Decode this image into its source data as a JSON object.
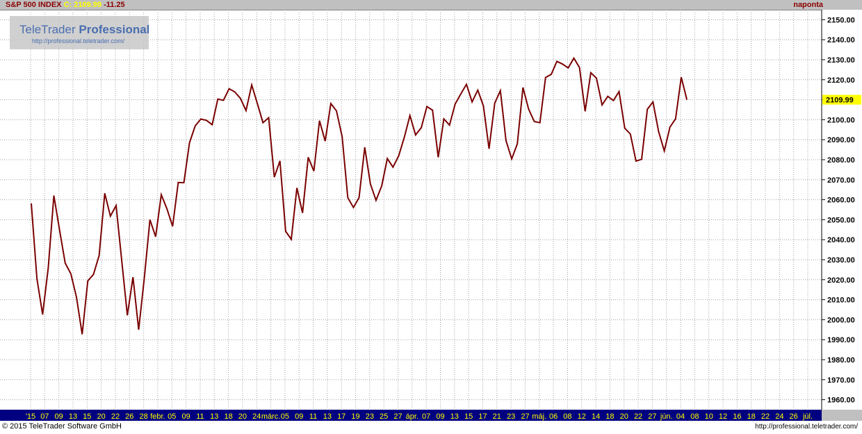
{
  "header": {
    "symbol": "S&P 500 INDEX",
    "close_label": "C:",
    "close_value": "2109.99",
    "change": "-11.25",
    "period": "naponta"
  },
  "watermark": {
    "brand": "TeleTrader",
    "brand_bold": "Professional",
    "url": "http://professional.teletrader.com/"
  },
  "footer": {
    "copyright": "© 2015 TeleTrader Software GmbH",
    "url": "http://professional.teletrader.com/"
  },
  "colors": {
    "line": "#7a0000",
    "grid": "#a0a0a0",
    "axis_bar": "#000080",
    "axis_text": "#ffff00",
    "last_price_bg": "#ffff00"
  },
  "chart_data": {
    "type": "line",
    "title": "S&P 500 INDEX",
    "xlabel": "",
    "ylabel": "",
    "ylim": [
      1955,
      2155
    ],
    "y_ticks": [
      "2150.00",
      "2140.00",
      "2130.00",
      "2120.00",
      "2110.00",
      "2100.00",
      "2090.00",
      "2080.00",
      "2070.00",
      "2060.00",
      "2050.00",
      "2040.00",
      "2030.00",
      "2020.00",
      "2010.00",
      "2000.00",
      "1990.00",
      "1980.00",
      "1970.00",
      "1960.00"
    ],
    "last_price_label": "2109.99",
    "grid": true,
    "x_tick_labels": [
      "'15",
      "07",
      "09",
      "13",
      "15",
      "20",
      "22",
      "26",
      "28",
      "febr.",
      "05",
      "09",
      "11",
      "13",
      "18",
      "20",
      "24",
      "márc.",
      "05",
      "09",
      "11",
      "13",
      "17",
      "19",
      "23",
      "25",
      "27",
      "ápr.",
      "07",
      "09",
      "13",
      "15",
      "17",
      "21",
      "23",
      "27",
      "máj.",
      "06",
      "08",
      "12",
      "14",
      "18",
      "20",
      "22",
      "27",
      "jún.",
      "04",
      "08",
      "10",
      "12",
      "16",
      "18",
      "22",
      "24",
      "26",
      "júl."
    ],
    "series": [
      {
        "values": [
          2058.2,
          2020.6,
          2002.6,
          2025.9,
          2062.1,
          2044.8,
          2028.3,
          2023.0,
          2011.3,
          1992.7,
          2019.4,
          2022.6,
          2032.1,
          2063.2,
          2051.8,
          2057.1,
          2029.6,
          2002.2,
          2021.3,
          1995.0,
          2020.9,
          2050.0,
          2041.5,
          2062.5,
          2055.5,
          2046.7,
          2068.6,
          2068.5,
          2088.5,
          2096.9,
          2100.3,
          2099.7,
          2097.5,
          2110.3,
          2109.7,
          2115.5,
          2113.9,
          2110.7,
          2104.6,
          2117.4,
          2108.1,
          2098.5,
          2101.0,
          2071.3,
          2079.4,
          2044.2,
          2040.2,
          2065.9,
          2053.4,
          2081.2,
          2074.3,
          2099.5,
          2089.3,
          2108.1,
          2104.4,
          2091.5,
          2061.0,
          2056.1,
          2061.0,
          2086.2,
          2067.9,
          2059.7,
          2066.9,
          2080.6,
          2076.3,
          2081.9,
          2091.2,
          2102.1,
          2092.4,
          2096.0,
          2106.6,
          2104.8,
          2081.2,
          2100.4,
          2097.3,
          2107.9,
          2112.9,
          2117.7,
          2108.9,
          2114.8,
          2106.9,
          2085.5,
          2108.3,
          2114.5,
          2089.5,
          2080.4,
          2088.0,
          2116.1,
          2105.3,
          2099.1,
          2098.5,
          2121.1,
          2122.7,
          2129.2,
          2127.8,
          2125.9,
          2130.8,
          2126.1,
          2104.2,
          2123.5,
          2120.8,
          2107.4,
          2111.7,
          2109.6,
          2114.1,
          2095.8,
          2092.8,
          2079.3,
          2080.2,
          2105.2,
          2108.9,
          2094.1,
          2084.4,
          2096.3,
          2100.4,
          2121.2,
          2110.0
        ]
      }
    ]
  }
}
